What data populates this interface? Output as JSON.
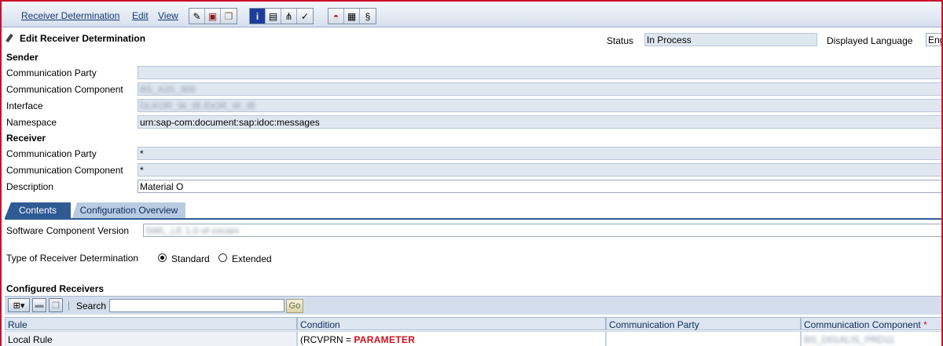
{
  "menu": {
    "receiver_determination": "Receiver Determination",
    "edit": "Edit",
    "view": "View"
  },
  "toolbar": {
    "group1": [
      "pencil-glasses-icon",
      "save-icon",
      "copy-icon"
    ],
    "group2": [
      "info-icon",
      "display-icon",
      "tree-icon",
      "check-icon"
    ],
    "group3": [
      "hat-icon",
      "table-icon",
      "script-icon"
    ]
  },
  "header": {
    "title": "Edit Receiver Determination",
    "status_label": "Status",
    "status_value": "In Process",
    "language_label": "Displayed Language",
    "language_value": "Eng"
  },
  "sender": {
    "section": "Sender",
    "party_label": "Communication Party",
    "party_value": "",
    "component_label": "Communication Component",
    "component_value": "BS_A20_300",
    "interface_label": "Interface",
    "interface_value": "DLKOR_W_IB.IDOR_W_IB",
    "namespace_label": "Namespace",
    "namespace_value": "urn:sap-com:document:sap:idoc:messages"
  },
  "receiver": {
    "section": "Receiver",
    "party_label": "Communication Party",
    "party_value": "*",
    "component_label": "Communication Component",
    "component_value": "*",
    "description_label": "Description",
    "description_value": "Material O"
  },
  "tabs": {
    "contents": "Contents",
    "overview": "Configuration Overview"
  },
  "contents": {
    "swcv_label": "Software Component Version",
    "swcv_value": "SWL_LE 1.0 of cocam",
    "type_label": "Type of Receiver Determination",
    "standard": "Standard",
    "extended": "Extended",
    "configured_label": "Configured Receivers",
    "search_label": "Search",
    "search_value": "",
    "go_label": "Go"
  },
  "table": {
    "headers": {
      "rule": "Rule",
      "condition": "Condition",
      "party": "Communication Party",
      "component": "Communication Component",
      "required_mark": "*"
    },
    "row": {
      "rule": "Local Rule",
      "condition_prefix": "(RCVPRN =",
      "condition_value": "PARAMETER",
      "party": "",
      "component": "BS_D01ALIS_PRD11"
    }
  }
}
